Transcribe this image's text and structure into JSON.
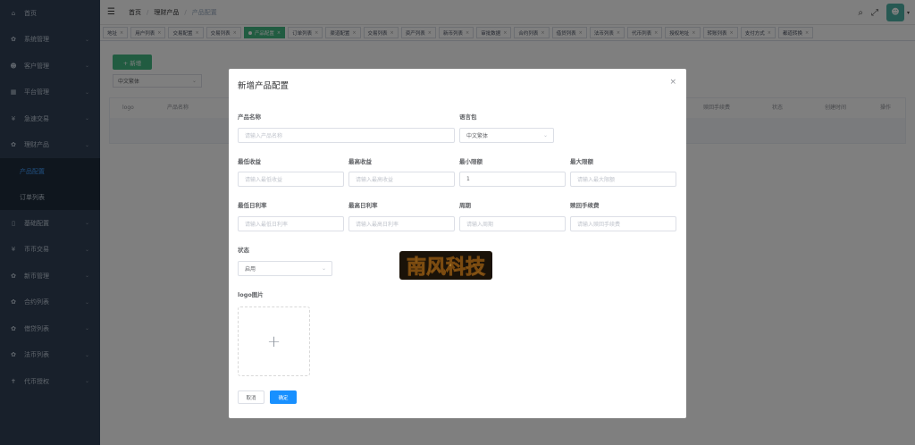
{
  "sidebar": {
    "items": [
      {
        "label": "首页",
        "icon": "home-icon",
        "glyph": "⌂",
        "arrow": false
      },
      {
        "label": "系统管理",
        "icon": "gear-icon",
        "glyph": "✿",
        "arrow": true
      },
      {
        "label": "客户管理",
        "icon": "user-icon",
        "glyph": "☻",
        "arrow": true
      },
      {
        "label": "平台管理",
        "icon": "grid-icon",
        "glyph": "▦",
        "arrow": true
      },
      {
        "label": "急速交易",
        "icon": "yen-icon",
        "glyph": "¥",
        "arrow": true
      },
      {
        "label": "理财产品",
        "icon": "gear-icon",
        "glyph": "✿",
        "arrow": true
      }
    ],
    "sub_items": [
      {
        "label": "产品配置",
        "active": true
      },
      {
        "label": "订单列表",
        "active": false
      }
    ],
    "items_after": [
      {
        "label": "基础配置",
        "icon": "book-icon",
        "glyph": "▯",
        "arrow": true
      },
      {
        "label": "币币交易",
        "icon": "yen-icon",
        "glyph": "¥",
        "arrow": true
      },
      {
        "label": "新币管理",
        "icon": "gear-icon",
        "glyph": "✿",
        "arrow": true
      },
      {
        "label": "合约列表",
        "icon": "gear-icon",
        "glyph": "✿",
        "arrow": true
      },
      {
        "label": "借贷列表",
        "icon": "gear-icon",
        "glyph": "✿",
        "arrow": true
      },
      {
        "label": "法币列表",
        "icon": "gear-icon",
        "glyph": "✿",
        "arrow": true
      },
      {
        "label": "代币授权",
        "icon": "pin-icon",
        "glyph": "✝",
        "arrow": true
      }
    ]
  },
  "header": {
    "breadcrumb": [
      "首页",
      "理财产品",
      "产品配置"
    ]
  },
  "tags": [
    {
      "label": "地址",
      "active": false
    },
    {
      "label": "用户列表",
      "active": false
    },
    {
      "label": "交易配置",
      "active": false
    },
    {
      "label": "交易列表",
      "active": false
    },
    {
      "label": "产品配置",
      "active": true
    },
    {
      "label": "订单列表",
      "active": false
    },
    {
      "label": "渠道配置",
      "active": false
    },
    {
      "label": "交易列表",
      "active": false
    },
    {
      "label": "资产列表",
      "active": false
    },
    {
      "label": "新币列表",
      "active": false
    },
    {
      "label": "审批数据",
      "active": false
    },
    {
      "label": "合约列表",
      "active": false
    },
    {
      "label": "借贷列表",
      "active": false
    },
    {
      "label": "法币列表",
      "active": false
    },
    {
      "label": "代币列表",
      "active": false
    },
    {
      "label": "授权地址",
      "active": false
    },
    {
      "label": "转账列表",
      "active": false
    },
    {
      "label": "支付方式",
      "active": false
    },
    {
      "label": "都道转换",
      "active": false
    }
  ],
  "page": {
    "add_label": "+ 新增",
    "lang_value": "中文繁体",
    "table_headers": [
      "logo",
      "产品名称",
      "赎回手续费",
      "状态",
      "创建时间",
      "操作"
    ]
  },
  "modal": {
    "title": "新增产品配置",
    "close": "×",
    "fields": {
      "name_label": "产品名称",
      "name_placeholder": "请输入产品名称",
      "lang_label": "语言包",
      "lang_value": "中文繁体",
      "min_income_label": "最低收益",
      "min_income_placeholder": "请输入最低收益",
      "max_income_label": "最高收益",
      "max_income_placeholder": "请输入最高收益",
      "min_limit_label": "最小限额",
      "min_limit_value": "1",
      "max_limit_label": "最大限额",
      "max_limit_placeholder": "请输入最大限额",
      "min_rate_label": "最低日利率",
      "min_rate_placeholder": "请输入最低日利率",
      "max_rate_label": "最高日利率",
      "max_rate_placeholder": "请输入最高日利率",
      "period_label": "周期",
      "period_placeholder": "请输入周期",
      "redeem_fee_label": "赎回手续费",
      "redeem_fee_placeholder": "请输入赎回手续费",
      "status_label": "状态",
      "status_value": "启用",
      "logo_label": "logo图片"
    },
    "cancel_label": "取消",
    "ok_label": "确定"
  },
  "watermark": {
    "text": "南风科技"
  }
}
